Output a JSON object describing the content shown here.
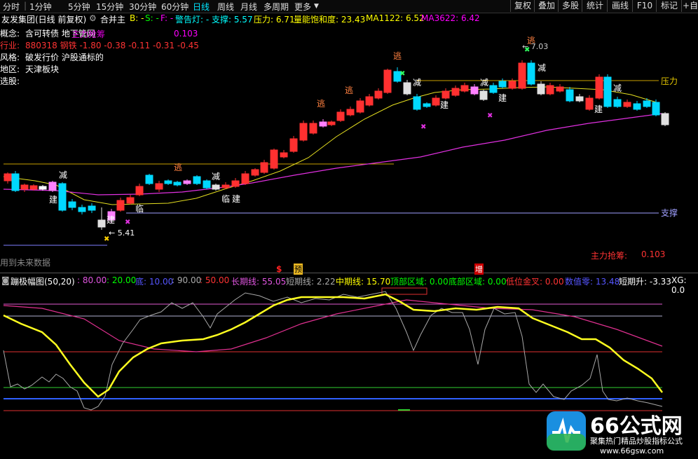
{
  "toolbar": {
    "periods": [
      "分时",
      "1分钟",
      "5分钟",
      "15分钟",
      "30分钟",
      "60分钟",
      "日线",
      "周线",
      "月线",
      "多周期",
      "更多"
    ],
    "active_period": "日线",
    "right_buttons": [
      "复权",
      "叠加",
      "多股",
      "统计",
      "画线",
      "F10",
      "标记",
      "+自"
    ]
  },
  "main_header": {
    "title": "友发集团(日线 前复权)",
    "merge": "合并主",
    "b": "B: -",
    "s": "S: -",
    "f": "F: -",
    "alarm": "警告灯: -",
    "support": "支撑: 5.57",
    "pressure": "压力: 6.71",
    "volume_sat": "量能饱和度: 23.43",
    "ma1122": "MA1122: 6.52",
    "ma3622": "MA3622: 6.42"
  },
  "stock_info": {
    "concept": "概念:",
    "concept_val": "含可转债 地下管网",
    "industry": "行业:",
    "industry_val": "880318 钢铁 -1.80 -0.38 -0.11 -0.31 -0.45",
    "style": "风格:",
    "style_val": "破发行价 沪股通标的",
    "region": "地区:",
    "region_val": "天津板块",
    "pick": "选股:",
    "overlay_text": "主力抢筹",
    "overlay_val": "0.103"
  },
  "chart_labels": {
    "pressure_label": "压力",
    "support_label": "支撑",
    "main_force": "主力抢筹:",
    "main_force_val": "0.103",
    "low_price": "5.41",
    "high_price": "7.03",
    "future_data": "用到未来数据",
    "jian": "减",
    "build": "建",
    "escape": "逃",
    "near": "临",
    "marker_s": "$",
    "marker_yu": "预",
    "marker_zeng": "增"
  },
  "indicator_header": {
    "name": "蹦极幅图(50,20)",
    "v80": ": 80.00",
    "v20": ": 20.00",
    "di": "底: 10.00",
    "v90": ": 90.00",
    "v50": ": 50.00",
    "long": "长期线: 55.05",
    "short": "短期线: 2.22",
    "mid": "中期线: 15.70",
    "top_zone": "顶部区域: 0.00",
    "bottom_zone": "底部区域: 0.00",
    "low_gold": "低位金叉: 0.00",
    "value": "数值零: 13.48",
    "short_up": "短期升: -3.33",
    "xg": "XG: 0.0"
  },
  "watermark": {
    "brand": "66公式网",
    "slogan": "聚集热门精品炒股指标公式",
    "url": "www.66gsw.com"
  },
  "chart_data": [
    {
      "type": "candlestick",
      "title": "友发集团(日线 前复权)",
      "series": [
        {
          "name": "MA1122",
          "last": 6.52
        },
        {
          "name": "MA3622",
          "last": 6.42
        }
      ],
      "support": 5.57,
      "pressure": 6.71,
      "marked_low": 5.41,
      "marked_high": 7.03,
      "main_force": 0.103
    },
    {
      "type": "line",
      "title": "蹦极幅图(50,20)",
      "levels": [
        80,
        20,
        10,
        90,
        50
      ],
      "series": [
        {
          "name": "长期线",
          "last": 55.05
        },
        {
          "name": "短期线",
          "last": 2.22
        },
        {
          "name": "中期线",
          "last": 15.7
        }
      ]
    }
  ]
}
